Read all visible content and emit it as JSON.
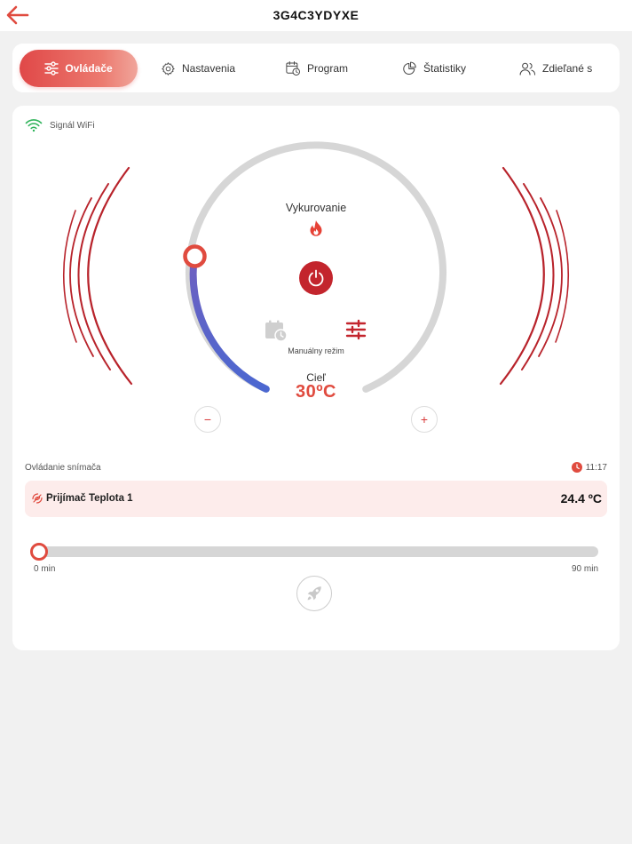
{
  "header": {
    "title": "3G4C3YDYXE",
    "back_icon": "arrow-left-icon"
  },
  "tabs": [
    {
      "label": "Ovládače",
      "icon": "sliders-icon",
      "active": true
    },
    {
      "label": "Nastavenia",
      "icon": "gear-icon",
      "active": false
    },
    {
      "label": "Program",
      "icon": "calendar-clock-icon",
      "active": false
    },
    {
      "label": "Štatistiky",
      "icon": "pie-chart-icon",
      "active": false
    },
    {
      "label": "Zdieľané s",
      "icon": "users-icon",
      "active": false
    }
  ],
  "status": {
    "wifi_label": "Signál WiFi"
  },
  "dial": {
    "mode_label": "Vykurovanie",
    "manual_label": "Manuálny režim",
    "target_label": "Cieľ",
    "target_value": "30ºC",
    "minus": "−",
    "plus": "+",
    "fill_fraction": 0.28
  },
  "sensor": {
    "header": "Ovládanie snímača",
    "time": "11:17",
    "name": "Prijímač Teplota 1",
    "value": "24.4 ºC"
  },
  "boost": {
    "min_label": "0 min",
    "max_label": "90 min",
    "value_min": 0
  },
  "colors": {
    "accent": "#e04b3f",
    "arc_blue": "#5b63c9",
    "arc_grey": "#d6d6d6",
    "wave_red": "#b8232b",
    "wifi_green": "#2fb35a"
  }
}
